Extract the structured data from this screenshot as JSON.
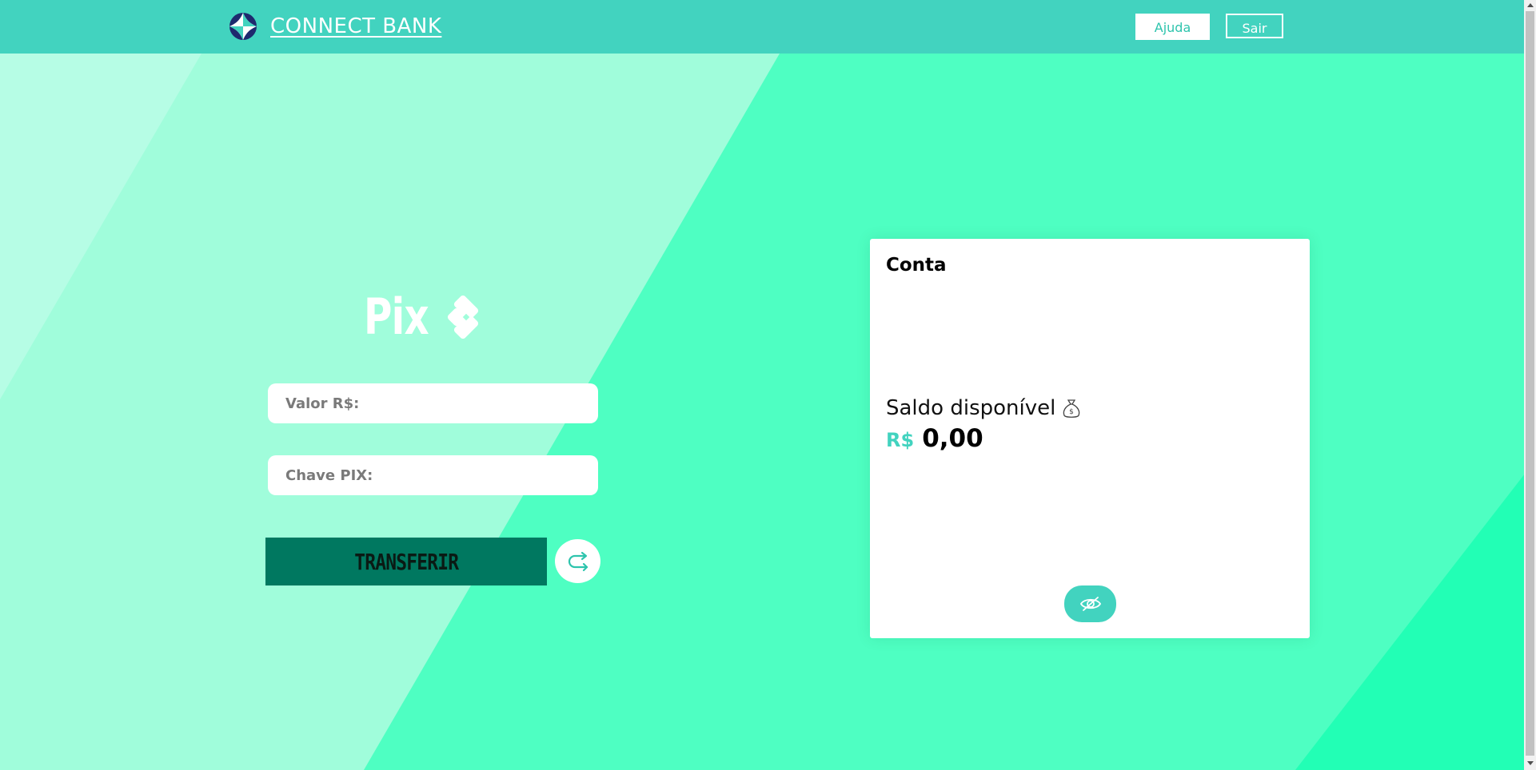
{
  "header": {
    "brand": "CONNECT BANK",
    "help_label": "Ajuda",
    "logout_label": "Sair"
  },
  "pix": {
    "title": "Pix",
    "amount_placeholder": "Valor R$:",
    "key_placeholder": "Chave PIX:",
    "transfer_label": "TRANSFERIR"
  },
  "account": {
    "title": "Conta",
    "balance_label": "Saldo disponível",
    "currency": "R$",
    "balance_value": "0,00"
  },
  "colors": {
    "header": "#42d3bf",
    "background": "#4effc2",
    "transfer_button": "#007860",
    "accent": "#42d3bf"
  },
  "icons": {
    "logo": "connect-bank-logo-icon",
    "pix": "pix-diamond-icon",
    "redo": "redo-arrow-icon",
    "money_bag": "money-bag-icon",
    "eye": "eye-slash-icon"
  }
}
